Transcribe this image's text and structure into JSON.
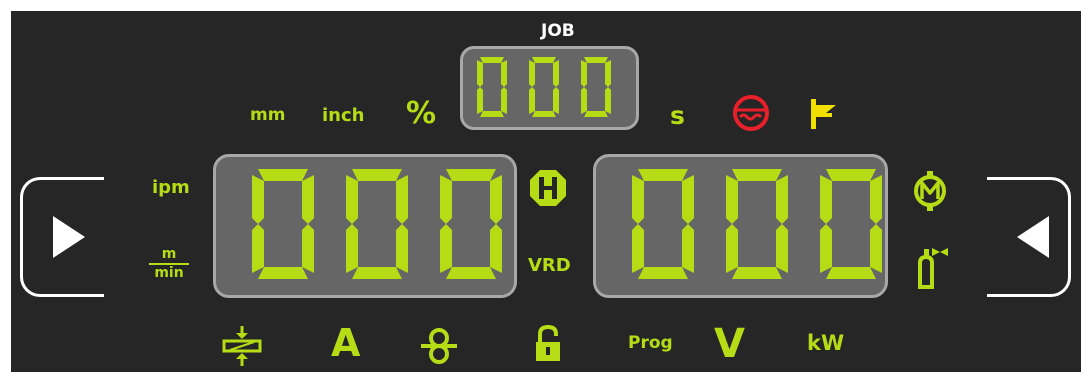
{
  "panel": {
    "job_label": "JOB",
    "job_display": "000",
    "left_display": "000",
    "right_display": "000",
    "units": {
      "mm": "mm",
      "inch": "inch",
      "percent": "%",
      "seconds": "s",
      "ipm": "ipm",
      "m_min_top": "m",
      "m_min_bottom": "min",
      "vrd": "VRD",
      "amps": "A",
      "prog": "Prog",
      "volts": "V",
      "kw": "kW"
    },
    "colors": {
      "accent": "#b5dc14",
      "panel_bg": "#262626",
      "display_bg": "#666666",
      "display_border": "#a8a8a8",
      "warning_red": "#e8202a",
      "yellow": "#f2e100"
    },
    "icons": {
      "left_button": "play-right-icon",
      "right_button": "play-left-icon",
      "hold": "hold-h-icon",
      "motor": "motor-m-icon",
      "gas": "gas-cylinder-icon",
      "cooling": "water-cooling-icon",
      "level": "level-flag-icon",
      "thickness": "material-thickness-icon",
      "inductance": "inductance-icon",
      "lock": "unlock-icon"
    }
  }
}
